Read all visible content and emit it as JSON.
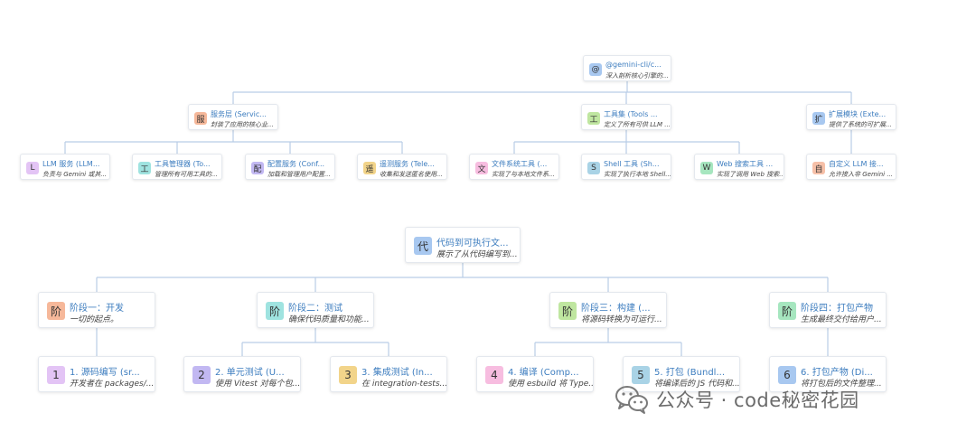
{
  "top_tree": {
    "root": {
      "icon_char": "@",
      "title": "@gemini-cli/c...",
      "desc": "深入剖析核心引擎的...",
      "color": "#a8c8f0"
    },
    "branches": [
      {
        "icon_char": "服",
        "title": "服务层 (Servic...",
        "desc": "封装了应用的核心业...",
        "color": "#f6b89a"
      },
      {
        "icon_char": "工",
        "title": "工具集 (Tools ...",
        "desc": "定义了所有可供 LLM ...",
        "color": "#bfe6a0"
      },
      {
        "icon_char": "扩",
        "title": "扩展模块 (Exte...",
        "desc": "提供了系统的可扩展...",
        "color": "#a8c8f0"
      }
    ],
    "leaves": [
      {
        "icon_char": "L",
        "title": "LLM 服务 (LLM...",
        "desc": "负责与 Gemini 或其...",
        "color": "#e3c4f5"
      },
      {
        "icon_char": "工",
        "title": "工具管理器 (To...",
        "desc": "管理所有可用工具的...",
        "color": "#9fe3e0"
      },
      {
        "icon_char": "配",
        "title": "配置服务 (Conf...",
        "desc": "加载和管理用户配置...",
        "color": "#c2b8f2"
      },
      {
        "icon_char": "遥",
        "title": "遥测服务 (Tele...",
        "desc": "收集和发送匿名使用...",
        "color": "#f2d48a"
      },
      {
        "icon_char": "文",
        "title": "文件系统工具 (...",
        "desc": "实现了与本地文件系...",
        "color": "#f7bde0"
      },
      {
        "icon_char": "S",
        "title": "Shell 工具 (Sh...",
        "desc": "实现了执行本地 Shell...",
        "color": "#a9d3e6"
      },
      {
        "icon_char": "W",
        "title": "Web 搜索工具 ...",
        "desc": "实现了调用 Web 搜索...",
        "color": "#a6e6bf"
      },
      {
        "icon_char": "自",
        "title": "自定义 LLM 接...",
        "desc": "允许接入非 Gemini ...",
        "color": "#f6c0a8"
      }
    ]
  },
  "bottom_tree": {
    "root": {
      "icon_char": "代",
      "title": "代码到可执行文...",
      "desc": "展示了从代码编写到...",
      "color": "#a8c8f0"
    },
    "stages": [
      {
        "icon_char": "阶",
        "title": "阶段一：开发",
        "desc": "一切的起点。",
        "color": "#f6b89a"
      },
      {
        "icon_char": "阶",
        "title": "阶段二：测试",
        "desc": "确保代码质量和功能...",
        "color": "#9fe3e0"
      },
      {
        "icon_char": "阶",
        "title": "阶段三：构建 (...",
        "desc": "将源码转换为可运行...",
        "color": "#bfe6a0"
      },
      {
        "icon_char": "阶",
        "title": "阶段四：打包产物",
        "desc": "生成最终交付给用户...",
        "color": "#a6e6bf"
      }
    ],
    "steps": [
      {
        "icon_char": "1",
        "title": "1. 源码编写 (sr...",
        "desc": "开发者在 packages/...",
        "color": "#e3c4f5"
      },
      {
        "icon_char": "2",
        "title": "2. 单元测试 (U...",
        "desc": "使用 Vitest 对每个包...",
        "color": "#c2b8f2"
      },
      {
        "icon_char": "3",
        "title": "3. 集成测试 (In...",
        "desc": "在 integration-tests...",
        "color": "#f2d48a"
      },
      {
        "icon_char": "4",
        "title": "4. 编译 (Comp...",
        "desc": "使用 esbuild 将 Type...",
        "color": "#f7bde0"
      },
      {
        "icon_char": "5",
        "title": "5. 打包 (Bundl...",
        "desc": "将编译后的 JS 代码和...",
        "color": "#a9d3e6"
      },
      {
        "icon_char": "6",
        "title": "6. 打包产物 (Di...",
        "desc": "将打包后的文件整理...",
        "color": "#a8c8f0"
      }
    ]
  },
  "watermark": {
    "text": "公众号 · code秘密花园",
    "icon": "wechat-logo-icon"
  },
  "colors": {
    "connector": "#b9cde6",
    "title_text": "#3d7dbf"
  }
}
